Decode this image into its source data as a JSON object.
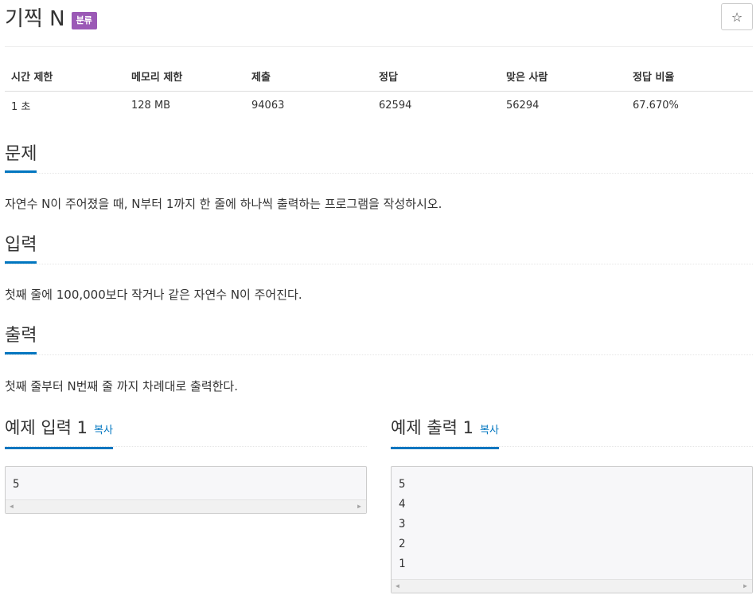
{
  "header": {
    "title": "기찍 N",
    "badge": "분류",
    "star_icon": "☆"
  },
  "info_table": {
    "headers": [
      "시간 제한",
      "메모리 제한",
      "제출",
      "정답",
      "맞은 사람",
      "정답 비율"
    ],
    "values": [
      "1 초",
      "128 MB",
      "94063",
      "62594",
      "56294",
      "67.670%"
    ]
  },
  "sections": {
    "problem": {
      "title": "문제",
      "text": "자연수 N이 주어졌을 때, N부터 1까지 한 줄에 하나씩 출력하는 프로그램을 작성하시오."
    },
    "input": {
      "title": "입력",
      "text": "첫째 줄에 100,000보다 작거나 같은 자연수 N이 주어진다."
    },
    "output": {
      "title": "출력",
      "text": "첫째 줄부터 N번째 줄 까지 차례대로 출력한다."
    }
  },
  "samples": {
    "input": {
      "title": "예제 입력 1",
      "copy_label": "복사",
      "lines": [
        "5"
      ]
    },
    "output": {
      "title": "예제 출력 1",
      "copy_label": "복사",
      "lines": [
        "5",
        "4",
        "3",
        "2",
        "1"
      ]
    }
  },
  "colors": {
    "badge": "#9b59b6",
    "accent": "#0076c0",
    "pre_background": "#f7f7f9"
  }
}
